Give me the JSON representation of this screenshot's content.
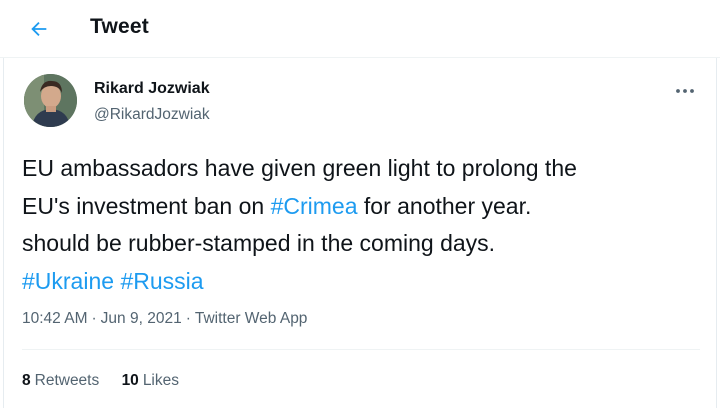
{
  "header": {
    "title": "Tweet",
    "back_icon": "arrow-left-icon"
  },
  "tweet": {
    "author_name": "Rikard Jozwiak",
    "author_handle": "@RikardJozwiak",
    "more_icon": "more-icon",
    "text": {
      "line1": "EU ambassadors have given green light to prolong the",
      "line2_pre": "EU's investment ban on ",
      "line2_tag": "#Crimea",
      "line2_post": " for another year.",
      "line3": "should be rubber-stamped in the coming days.",
      "tag_ukraine": "#Ukraine",
      "tag_russia": "#Russia"
    },
    "time": "10:42 AM",
    "date": "Jun 9, 2021",
    "source": "Twitter Web App",
    "separator": "·",
    "stats": {
      "retweets_count": "8",
      "retweets_label": "Retweets",
      "likes_count": "10",
      "likes_label": "Likes"
    }
  },
  "colors": {
    "accent": "#1d9bf0",
    "text": "#0f1419",
    "secondary": "#536471"
  }
}
